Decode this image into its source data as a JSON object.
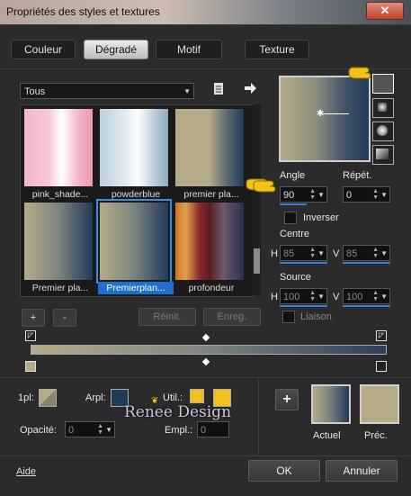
{
  "window": {
    "title": "Propriétés des styles et textures",
    "close_glyph": "✕"
  },
  "tabs": [
    {
      "label": "Couleur"
    },
    {
      "label": "Dégradé"
    },
    {
      "label": "Motif"
    },
    {
      "label": "Texture"
    }
  ],
  "category_select": {
    "value": "Tous"
  },
  "gradients": [
    {
      "name": "pink_shade..."
    },
    {
      "name": "powderblue"
    },
    {
      "name": "premier pla..."
    },
    {
      "name": "Premier pla..."
    },
    {
      "name": "Premierplan..."
    },
    {
      "name": "profondeur"
    }
  ],
  "list_buttons": {
    "add": "+",
    "remove": "-",
    "reset": "Réinit.",
    "save": "Enreg."
  },
  "style": {
    "angle_label": "Angle",
    "angle_value": "90",
    "repeat_label": "Répét.",
    "repeat_value": "0",
    "invert_label": "Inverser",
    "center_label": "Centre",
    "center_h_label": "H",
    "center_h": "85",
    "center_v_label": "V",
    "center_v": "85",
    "source_label": "Source",
    "source_h_label": "H",
    "source_h": "100",
    "source_v_label": "V",
    "source_v": "100",
    "link_label": "Liaison"
  },
  "stops": {
    "first_label": "1pl:",
    "arpl_label": "Arpl:",
    "util_label": "Util.:",
    "opacity_label": "Opacité:",
    "opacity_value": "0",
    "empl_label": "Empl.:",
    "empl_value": "0"
  },
  "watermark": "Renee Design",
  "current": {
    "add": "+",
    "actual_label": "Actuel",
    "previous_label": "Préc."
  },
  "footer": {
    "help": "Aide",
    "ok": "OK",
    "cancel": "Annuler"
  },
  "colors": {
    "foreground": "#b5ab88",
    "background": "#233a5a",
    "accent": "#1e6fd0",
    "yellow": "#f2c21b"
  }
}
